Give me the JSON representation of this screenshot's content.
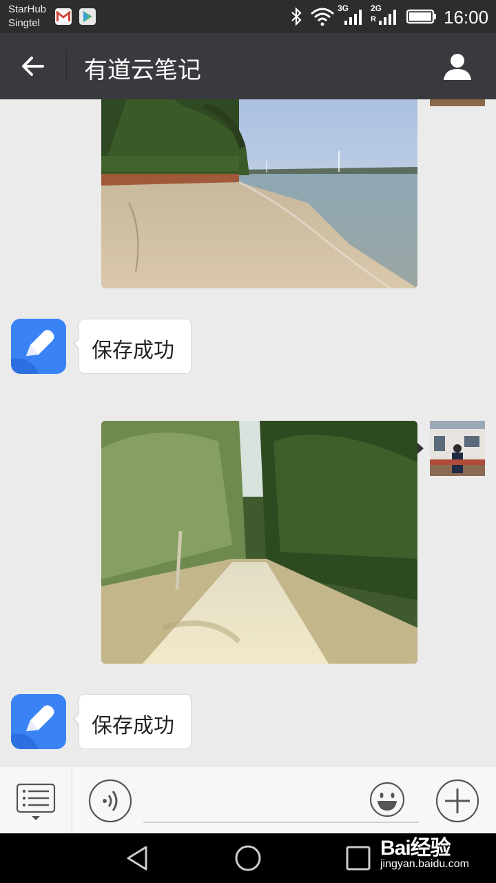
{
  "status_bar": {
    "carrier_1": "StarHub",
    "carrier_2": "Singtel",
    "network_1": "3G",
    "network_2": "2G",
    "time": "16:00"
  },
  "header": {
    "title": "有道云笔记"
  },
  "messages": [
    {
      "type": "image",
      "sender": "user",
      "scene": "beach"
    },
    {
      "type": "text",
      "sender": "bot",
      "text": "保存成功"
    },
    {
      "type": "image",
      "sender": "user",
      "scene": "forest-path"
    },
    {
      "type": "text",
      "sender": "bot",
      "text": "保存成功"
    }
  ],
  "watermark": {
    "main": "Bai经验",
    "sub": "jingyan.baidu.com"
  },
  "colors": {
    "status_bar_bg": "#2d2d2d",
    "title_bar_bg": "#393a3f",
    "chat_bg": "#ebebeb",
    "bot_avatar_blue": "#3a83f5"
  }
}
